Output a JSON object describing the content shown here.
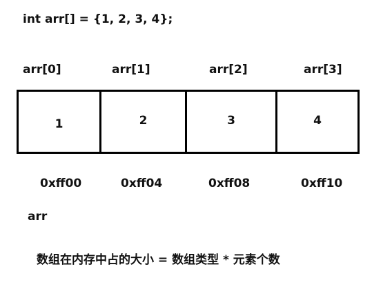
{
  "code": "int arr[] = {1, 2, 3, 4};",
  "indices": [
    "arr[0]",
    "arr[1]",
    "arr[2]",
    "arr[3]"
  ],
  "values": [
    "1",
    "2",
    "3",
    "4"
  ],
  "addresses": [
    "0xff00",
    "0xff04",
    "0xff08",
    "0xff10"
  ],
  "array_name": "arr",
  "formula": "数组在内存中占的大小 = 数组类型 * 元素个数"
}
